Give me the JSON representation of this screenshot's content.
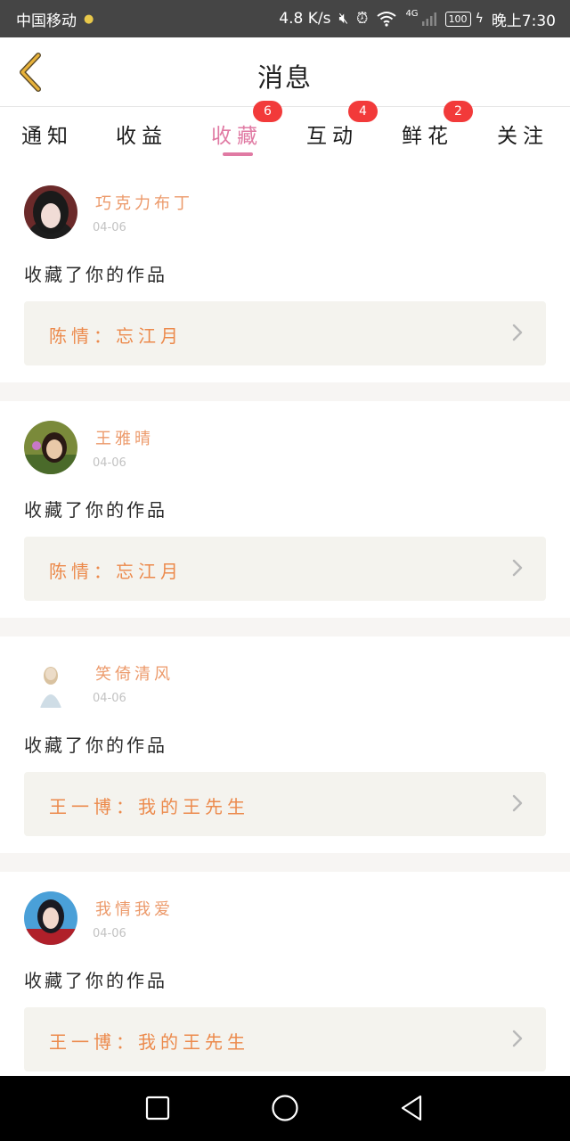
{
  "status_bar": {
    "carrier": "中国移动",
    "speed": "4.8 K/s",
    "network": "4G",
    "battery": "100",
    "time": "晚上7:30"
  },
  "header": {
    "title": "消息"
  },
  "tabs": [
    {
      "label": "通知",
      "badge": "",
      "active": false
    },
    {
      "label": "收益",
      "badge": "",
      "active": false
    },
    {
      "label": "收藏",
      "badge": "6",
      "active": true
    },
    {
      "label": "互动",
      "badge": "4",
      "active": false
    },
    {
      "label": "鲜花",
      "badge": "2",
      "active": false
    },
    {
      "label": "关注",
      "badge": "",
      "active": false
    }
  ],
  "feed": [
    {
      "user": "巧克力布丁",
      "date": "04-06",
      "action": "收藏了你的作品",
      "work": "陈情：忘江月"
    },
    {
      "user": "王雅晴",
      "date": "04-06",
      "action": "收藏了你的作品",
      "work": "陈情：忘江月"
    },
    {
      "user": "笑倚清风",
      "date": "04-06",
      "action": "收藏了你的作品",
      "work": "王一博：我的王先生"
    },
    {
      "user": "我情我爱",
      "date": "04-06",
      "action": "收藏了你的作品",
      "work": "王一博：我的王先生"
    }
  ],
  "colors": {
    "accent": "#e07aa3",
    "badge": "#f23a3a",
    "username": "#ec9a6b",
    "work_title": "#ec8a4c",
    "back_arrow": "#e8b23a"
  }
}
